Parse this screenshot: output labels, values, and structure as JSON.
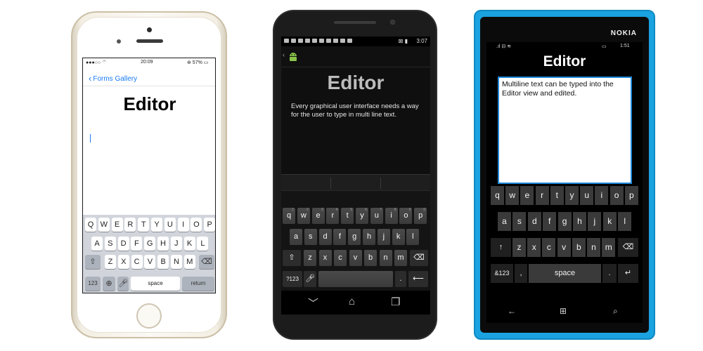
{
  "iphone": {
    "status": {
      "signal": "●●●○○ ⌔",
      "time": "20:09",
      "battery": "⊛ 57% ▭"
    },
    "nav": {
      "back_label": "Forms Gallery"
    },
    "title": "Editor",
    "keyboard": {
      "row1": [
        "Q",
        "W",
        "E",
        "R",
        "T",
        "Y",
        "U",
        "I",
        "O",
        "P"
      ],
      "row2": [
        "A",
        "S",
        "D",
        "F",
        "G",
        "H",
        "J",
        "K",
        "L"
      ],
      "row3": [
        "Z",
        "X",
        "C",
        "V",
        "B",
        "N",
        "M"
      ],
      "numbers_label": "123",
      "space_label": "space",
      "return_label": "return"
    }
  },
  "android": {
    "status": {
      "time": "3:07"
    },
    "title": "Editor",
    "body": "Every graphical user interface needs a way for the user to type in multi line text.",
    "keyboard": {
      "row1": [
        "q",
        "w",
        "e",
        "r",
        "t",
        "y",
        "u",
        "i",
        "o",
        "p"
      ],
      "row1_hints": [
        "1",
        "2",
        "3",
        "4",
        "5",
        "6",
        "7",
        "8",
        "9",
        "0"
      ],
      "row2": [
        "a",
        "s",
        "d",
        "f",
        "g",
        "h",
        "j",
        "k",
        "l"
      ],
      "row3": [
        "z",
        "x",
        "c",
        "v",
        "b",
        "n",
        "m"
      ],
      "symbols_label": "?123",
      "period_label": "."
    }
  },
  "windows_phone": {
    "brand": "NOKIA",
    "status": {
      "time": "1:51"
    },
    "title": "Editor",
    "editor_text": "Multiline text can be typed into the Editor view and edited.",
    "keyboard": {
      "row1": [
        "q",
        "w",
        "e",
        "r",
        "t",
        "y",
        "u",
        "i",
        "o",
        "p"
      ],
      "row2": [
        "a",
        "s",
        "d",
        "f",
        "g",
        "h",
        "j",
        "k",
        "l"
      ],
      "row3": [
        "z",
        "x",
        "c",
        "v",
        "b",
        "n",
        "m"
      ],
      "symbols_label": "&123",
      "comma_label": ",",
      "space_label": "space",
      "period_label": "."
    }
  },
  "colors": {
    "ios_tint": "#1a7cf5",
    "wp_body": "#1aa3e0",
    "wp_accent": "#1e88d8"
  }
}
